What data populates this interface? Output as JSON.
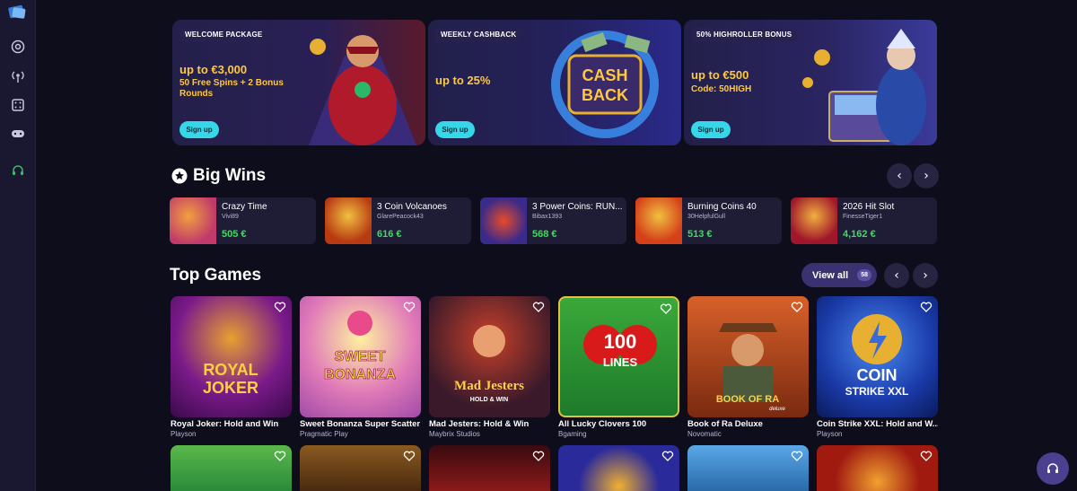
{
  "colors": {
    "accent": "#35d7e8",
    "bonus_text": "#ffc83d",
    "win_amount": "#37e05a",
    "background": "#0e0d1c",
    "sidebar": "#191830"
  },
  "sidebar": {
    "logo": "casino-logo-icon",
    "items": [
      {
        "icon": "chip-icon"
      },
      {
        "icon": "live-broadcast-icon"
      },
      {
        "icon": "dice-icon"
      },
      {
        "icon": "gamepad-icon"
      },
      {
        "icon": "headset-icon"
      }
    ]
  },
  "promos": [
    {
      "tag": "WELCOME PACKAGE",
      "title": "up to €3,000",
      "subtitle": "50 Free Spins + 2 Bonus Rounds",
      "button": "Sign up"
    },
    {
      "tag": "WEEKLY CASHBACK",
      "title": "up to 25%",
      "subtitle": "",
      "button": "Sign up",
      "art_text_1": "CASH",
      "art_text_2": "BACK"
    },
    {
      "tag": "50% HIGHROLLER BONUS",
      "title": "up to €500",
      "subtitle": "Code: 50HIGH",
      "button": "Sign up"
    }
  ],
  "big_wins": {
    "title": "Big Wins",
    "prev": "‹",
    "next": "›",
    "items": [
      {
        "game": "Crazy Time",
        "user": "Vivi89",
        "amount": "505 €",
        "color": "#c23a6a"
      },
      {
        "game": "3 Coin Volcanoes",
        "user": "GlarePeacock43",
        "amount": "616 €",
        "color": "#b83a12"
      },
      {
        "game": "3 Power Coins: RUN...",
        "user": "Bibax1393",
        "amount": "568 €",
        "color": "#3a2a8a"
      },
      {
        "game": "Burning Coins 40",
        "user": "30HelpfulGull",
        "amount": "513 €",
        "color": "#d4401a"
      },
      {
        "game": "2026 Hit Slot",
        "user": "FinesseTiger1",
        "amount": "4,162 €",
        "color": "#a0162a"
      }
    ]
  },
  "top_games": {
    "title": "Top Games",
    "view_all": "View all",
    "count": "58",
    "prev": "‹",
    "next": "›",
    "games": [
      {
        "name": "Royal Joker: Hold and Win",
        "provider": "Playson",
        "bg": "#5a1a6e",
        "art_1": "ROYAL",
        "art_2": "JOKER"
      },
      {
        "name": "Sweet Bonanza Super Scatter",
        "provider": "Pragmatic Play",
        "bg": "#e07ab8",
        "art_1": "SWEET",
        "art_2": "BONANZA"
      },
      {
        "name": "Mad Jesters: Hold & Win",
        "provider": "Maybrix Studios",
        "bg": "#3a1a2a",
        "art_1": "Mad Jesters",
        "art_2": "HOLD & WIN"
      },
      {
        "name": "All Lucky Clovers 100",
        "provider": "Bgaming",
        "bg": "#1e7a2a",
        "art_1": "100",
        "art_2": "LINES"
      },
      {
        "name": "Book of Ra Deluxe",
        "provider": "Novomatic",
        "bg": "#7a2a10",
        "art_1": "BOOK OF RA",
        "art_2": "deluxe"
      },
      {
        "name": "Coin Strike XXL: Hold and W...",
        "provider": "Playson",
        "bg": "#1a3aa8",
        "art_1": "COIN",
        "art_2": "STRIKE XXL"
      }
    ],
    "second_row": [
      {
        "bg": "#2a8a3a"
      },
      {
        "bg": "#6a3a10"
      },
      {
        "bg": "#5a0a10"
      },
      {
        "bg": "#2a2a9a"
      },
      {
        "bg": "#2a6aa8"
      },
      {
        "bg": "#a01a10"
      }
    ]
  },
  "support_button": "headset-icon"
}
